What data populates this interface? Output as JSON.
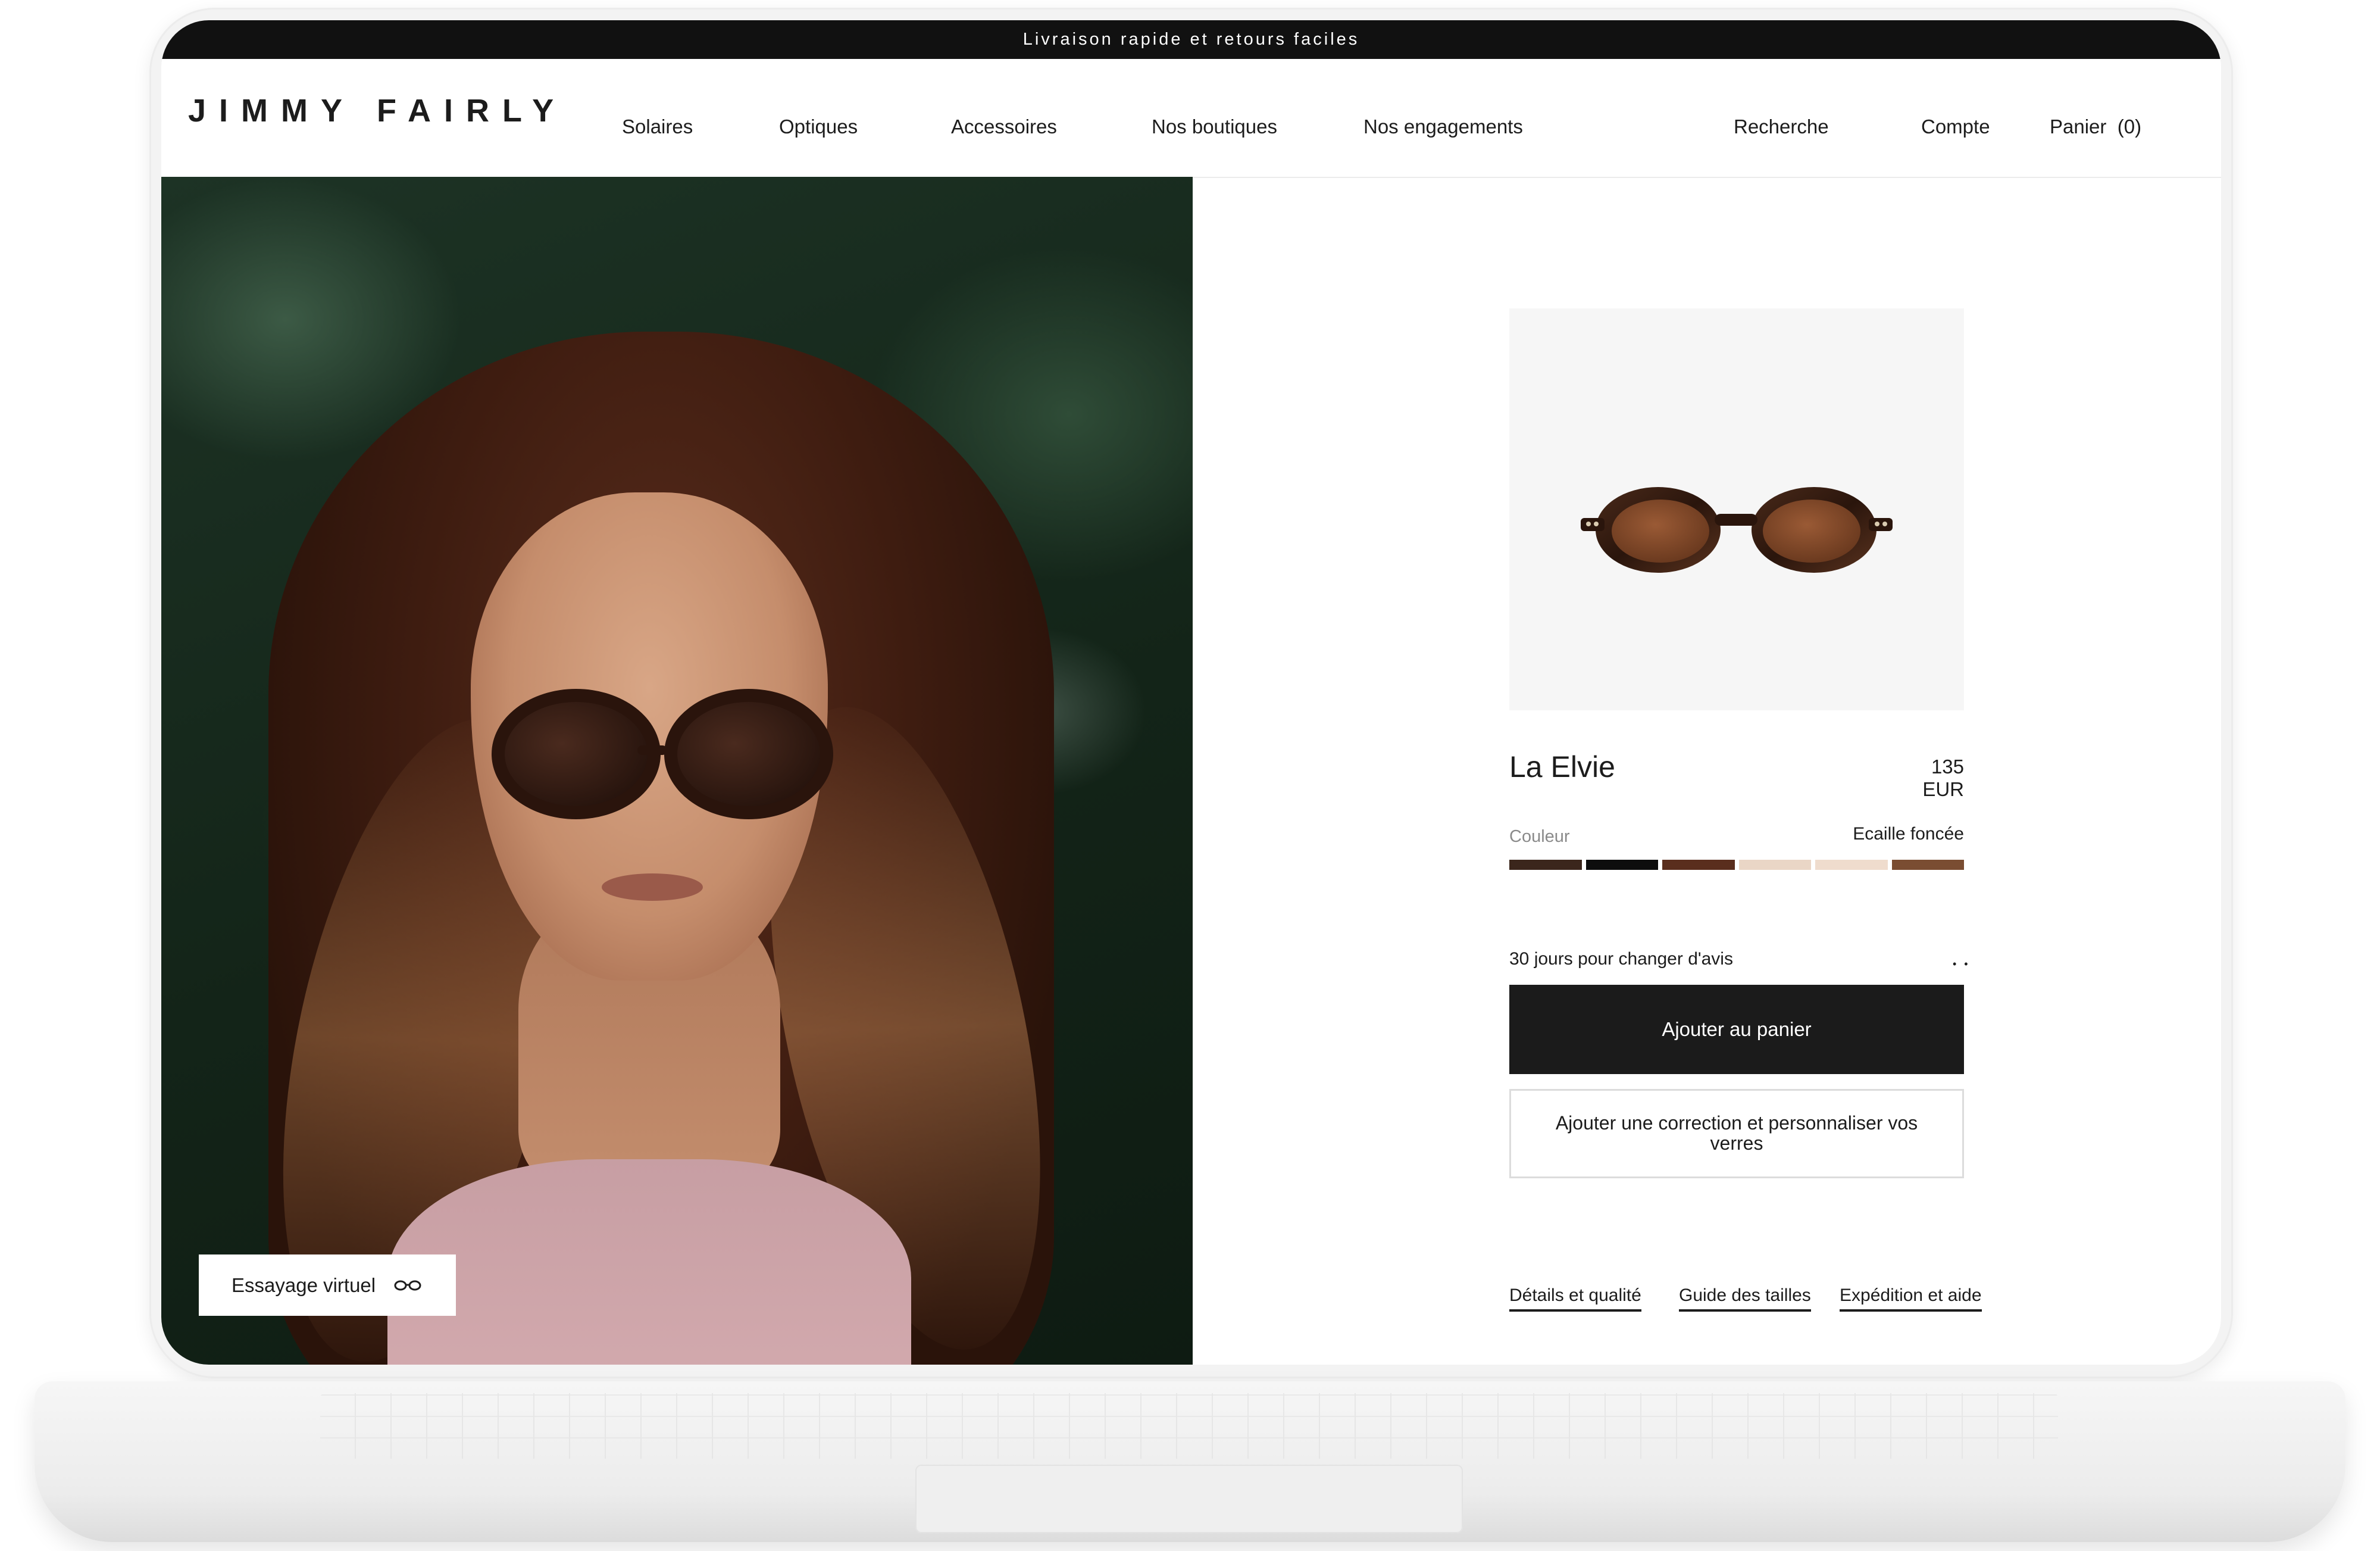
{
  "announcement": "Livraison rapide et retours faciles",
  "header": {
    "logo": "JIMMY FAIRLY",
    "nav": [
      "Solaires",
      "Optiques",
      "Accessoires",
      "Nos boutiques",
      "Nos engagements"
    ],
    "utility": {
      "search": "Recherche",
      "account": "Compte",
      "cart": "Panier  (0)"
    }
  },
  "hero": {
    "virtual_try_on": "Essayage virtuel"
  },
  "product": {
    "name": "La Elvie",
    "price": "135 EUR",
    "color_label": "Couleur",
    "color_value": "Ecaille foncée",
    "swatches": [
      "#3b261c",
      "#0d0d0d",
      "#5a2e1d",
      "#ead6c6",
      "#efdccd",
      "#7a4d32"
    ],
    "returns_text": "30 jours pour changer d'avis",
    "returns_dots": "• •",
    "add_to_cart": "Ajouter au panier",
    "add_correction": "Ajouter une correction et personnaliser vos verres"
  },
  "footer_links": [
    "Détails et qualité",
    "Guide des tailles",
    "Expédition et aide"
  ]
}
